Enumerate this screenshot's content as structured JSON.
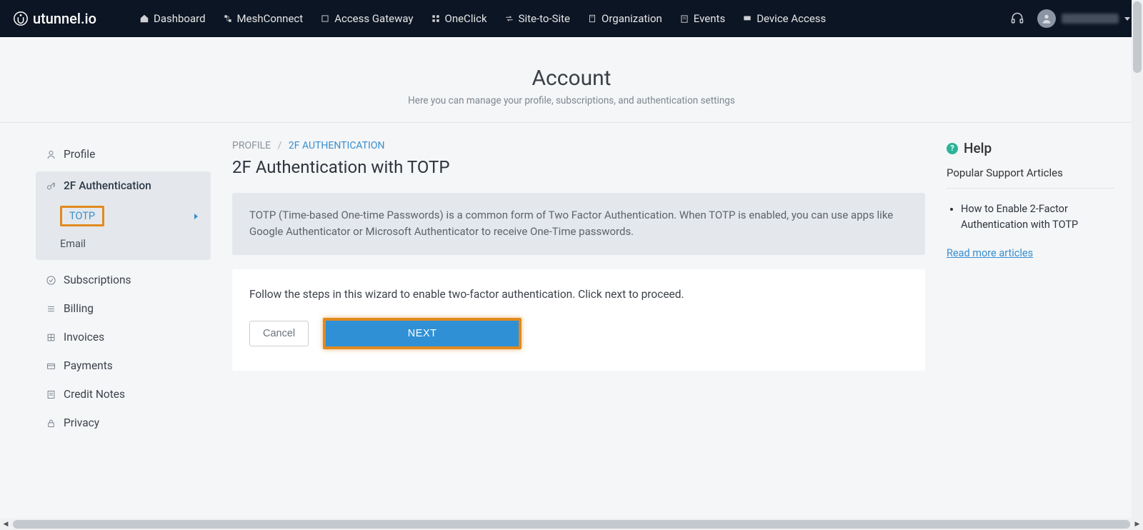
{
  "brand": "utunnel.io",
  "nav": {
    "items": [
      {
        "label": "Dashboard"
      },
      {
        "label": "MeshConnect"
      },
      {
        "label": "Access Gateway"
      },
      {
        "label": "OneClick"
      },
      {
        "label": "Site-to-Site"
      },
      {
        "label": "Organization"
      },
      {
        "label": "Events"
      },
      {
        "label": "Device Access"
      }
    ]
  },
  "page": {
    "title": "Account",
    "subtitle": "Here you can manage your profile, subscriptions, and authentication settings"
  },
  "sidebar": {
    "profile": "Profile",
    "twofa": "2F Authentication",
    "totp": "TOTP",
    "email": "Email",
    "subscriptions": "Subscriptions",
    "billing": "Billing",
    "invoices": "Invoices",
    "payments": "Payments",
    "credit_notes": "Credit Notes",
    "privacy": "Privacy"
  },
  "breadcrumb": {
    "root": "PROFILE",
    "current": "2F AUTHENTICATION"
  },
  "main": {
    "heading": "2F Authentication with TOTP",
    "info": "TOTP (Time-based One-time Passwords) is a common form of Two Factor Authentication. When TOTP is enabled, you can use apps like Google Authenticator or Microsoft Authenticator to receive One-Time passwords.",
    "wizard_text": "Follow the steps in this wizard to enable two-factor authentication. Click next to proceed.",
    "cancel": "Cancel",
    "next": "NEXT"
  },
  "help": {
    "title": "Help",
    "subtitle": "Popular Support Articles",
    "article1": "How to Enable 2-Factor Authentication with TOTP",
    "more": "Read more articles"
  }
}
